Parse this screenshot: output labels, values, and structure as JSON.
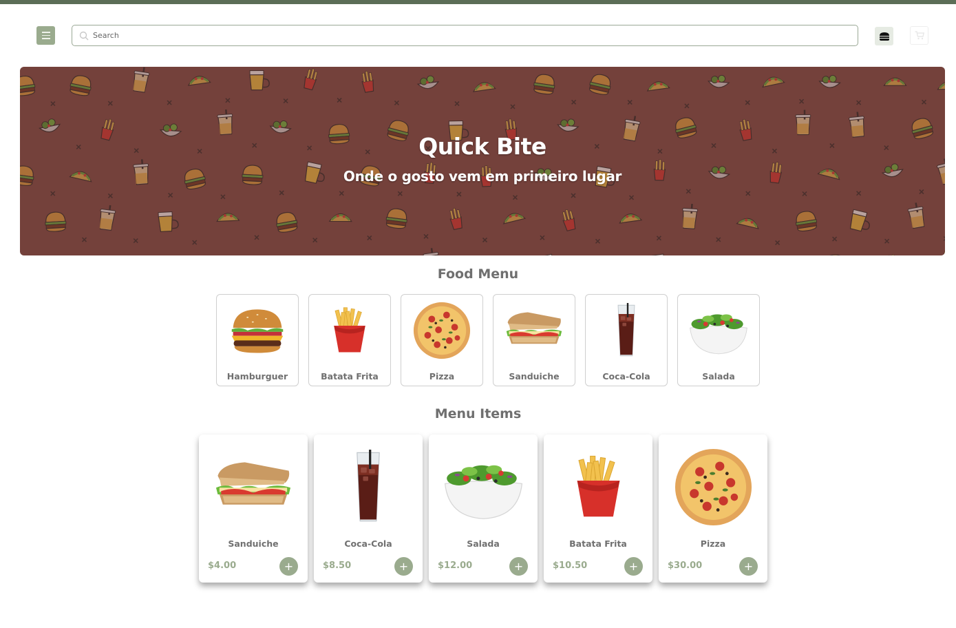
{
  "header": {
    "menu_icon": "hamburger-menu-icon",
    "search": {
      "placeholder": "Search",
      "value": ""
    },
    "logo_icon": "burger-logo-icon",
    "cart_icon": "cart-icon"
  },
  "hero": {
    "title": "Quick Bite",
    "subtitle": "Onde o gosto vem em primeiro lugar",
    "background_color": "#7a4640"
  },
  "food_menu": {
    "title": "Food Menu",
    "categories": [
      {
        "label": "Hamburguer",
        "icon": "hamburger-image"
      },
      {
        "label": "Batata Frita",
        "icon": "fries-image"
      },
      {
        "label": "Pizza",
        "icon": "pizza-image"
      },
      {
        "label": "Sanduiche",
        "icon": "sandwich-image"
      },
      {
        "label": "Coca-Cola",
        "icon": "cola-image"
      },
      {
        "label": "Salada",
        "icon": "salad-image"
      }
    ]
  },
  "menu_items": {
    "title": "Menu Items",
    "add_label": "+",
    "items": [
      {
        "name": "Sanduiche",
        "price": "$4.00",
        "icon": "sandwich-image"
      },
      {
        "name": "Coca-Cola",
        "price": "$8.50",
        "icon": "cola-image"
      },
      {
        "name": "Salada",
        "price": "$12.00",
        "icon": "salad-image"
      },
      {
        "name": "Batata Frita",
        "price": "$10.50",
        "icon": "fries-image"
      },
      {
        "name": "Pizza",
        "price": "$30.00",
        "icon": "pizza-image"
      }
    ]
  },
  "colors": {
    "accent": "#9aab8e",
    "top_strip": "#5c6e57",
    "hero": "#7a4640",
    "heading_text": "#6f6f6f"
  }
}
